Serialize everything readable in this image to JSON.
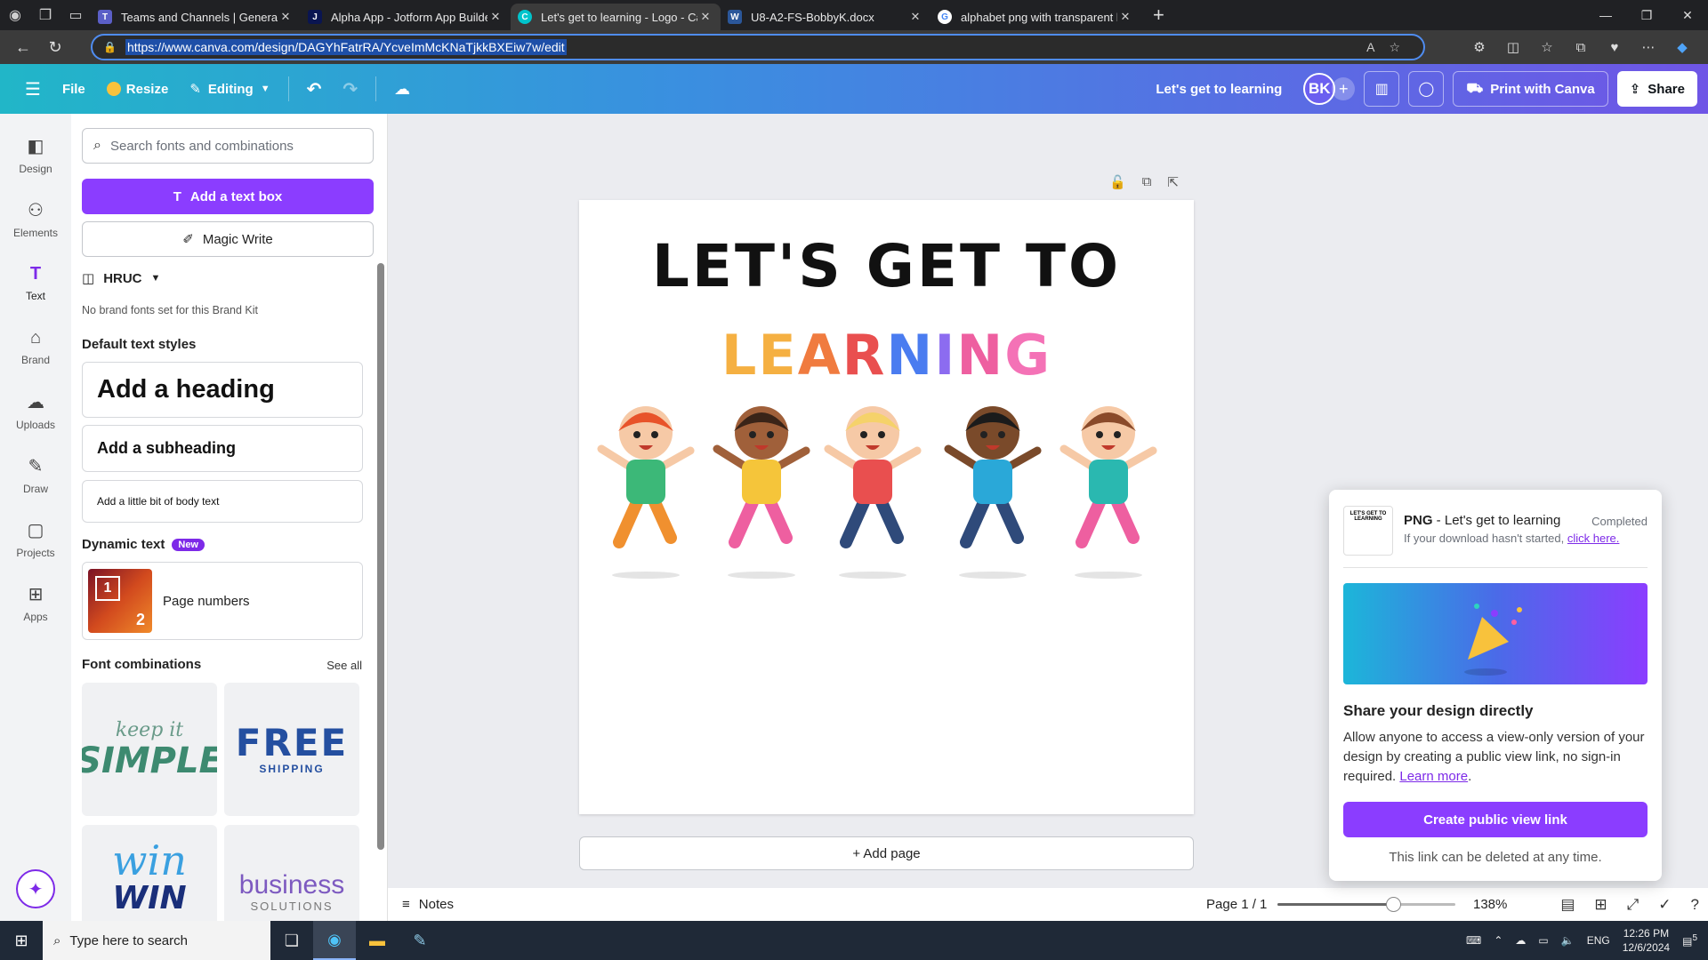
{
  "browser": {
    "tabs": [
      {
        "title": "Teams and Channels | General | M",
        "favicon_color": "#5b5fc7"
      },
      {
        "title": "Alpha App - Jotform App Builder",
        "favicon_color": "#0a1551"
      },
      {
        "title": "Let's get to learning - Logo - Can",
        "favicon_color": "#00c4cc"
      },
      {
        "title": "U8-A2-FS-BobbyK.docx",
        "favicon_color": "#2b579a"
      },
      {
        "title": "alphabet png with transparent ba",
        "favicon_color": "#ffffff"
      }
    ],
    "url": "https://www.canva.com/design/DAGYhFatrRA/YcveImMcKNaTjkkBXEiw7w/edit"
  },
  "header": {
    "file_label": "File",
    "resize_label": "Resize",
    "editing_label": "Editing",
    "design_title": "Let's get to learning",
    "avatar_initials": "BK",
    "print_label": "Print with Canva",
    "share_label": "Share"
  },
  "rail": [
    {
      "label": "Design",
      "icon": "design-icon"
    },
    {
      "label": "Elements",
      "icon": "elements-icon"
    },
    {
      "label": "Text",
      "icon": "text-icon"
    },
    {
      "label": "Brand",
      "icon": "brand-icon"
    },
    {
      "label": "Uploads",
      "icon": "uploads-icon"
    },
    {
      "label": "Draw",
      "icon": "draw-icon"
    },
    {
      "label": "Projects",
      "icon": "projects-icon"
    },
    {
      "label": "Apps",
      "icon": "apps-icon"
    }
  ],
  "panel": {
    "search_placeholder": "Search fonts and combinations",
    "add_text_box": "Add a text box",
    "magic_write": "Magic Write",
    "brand_kit": "HRUC",
    "no_brand_fonts": "No brand fonts set for this Brand Kit",
    "default_styles_heading": "Default text styles",
    "heading": "Add a heading",
    "subheading": "Add a subheading",
    "body": "Add a little bit of body text",
    "dynamic_heading": "Dynamic text",
    "new_badge": "New",
    "page_numbers": "Page numbers",
    "page_numbers_thumb": [
      "1",
      "2"
    ],
    "font_combos_heading": "Font combinations",
    "see_all": "See all",
    "combos": [
      {
        "line1": "keep it",
        "line2": "SIMPLE"
      },
      {
        "line1": "FREE",
        "line2": "SHIPPING"
      },
      {
        "line1": "win",
        "line2": "WIN"
      },
      {
        "line1": "business",
        "line2": "SOLUTIONS"
      }
    ]
  },
  "canvas": {
    "title_line1": "LET'S GET TO",
    "title_line2_letters": [
      {
        "ch": "L",
        "color": "#f5b042"
      },
      {
        "ch": "E",
        "color": "#f5b042"
      },
      {
        "ch": "A",
        "color": "#f07b3f"
      },
      {
        "ch": "R",
        "color": "#e94f4f"
      },
      {
        "ch": "N",
        "color": "#4a7cf0"
      },
      {
        "ch": "I",
        "color": "#8c6cf0"
      },
      {
        "ch": "N",
        "color": "#ee5fa0"
      },
      {
        "ch": "G",
        "color": "#f472b6"
      }
    ],
    "add_page": "+ Add page"
  },
  "bottom": {
    "notes": "Notes",
    "page_indicator": "Page 1 / 1",
    "zoom": "138%",
    "zoom_fraction": 0.65
  },
  "popup": {
    "thumb_text": "LET'S GET TO LEARNING",
    "file_type": "PNG",
    "file_name": " - Let's get to learning",
    "status": "Completed",
    "hint": "If your download hasn't started, ",
    "hint_link": "click here.",
    "heading": "Share your design directly",
    "body": "Allow anyone to access a view-only version of your design by creating a public view link, no sign-in required. ",
    "learn_more": "Learn more",
    "button": "Create public view link",
    "footer": "This link can be deleted at any time."
  },
  "taskbar": {
    "search_placeholder": "Type here to search",
    "lang": "ENG",
    "time": "12:26 PM",
    "date": "12/6/2024",
    "notif_count": "5"
  }
}
